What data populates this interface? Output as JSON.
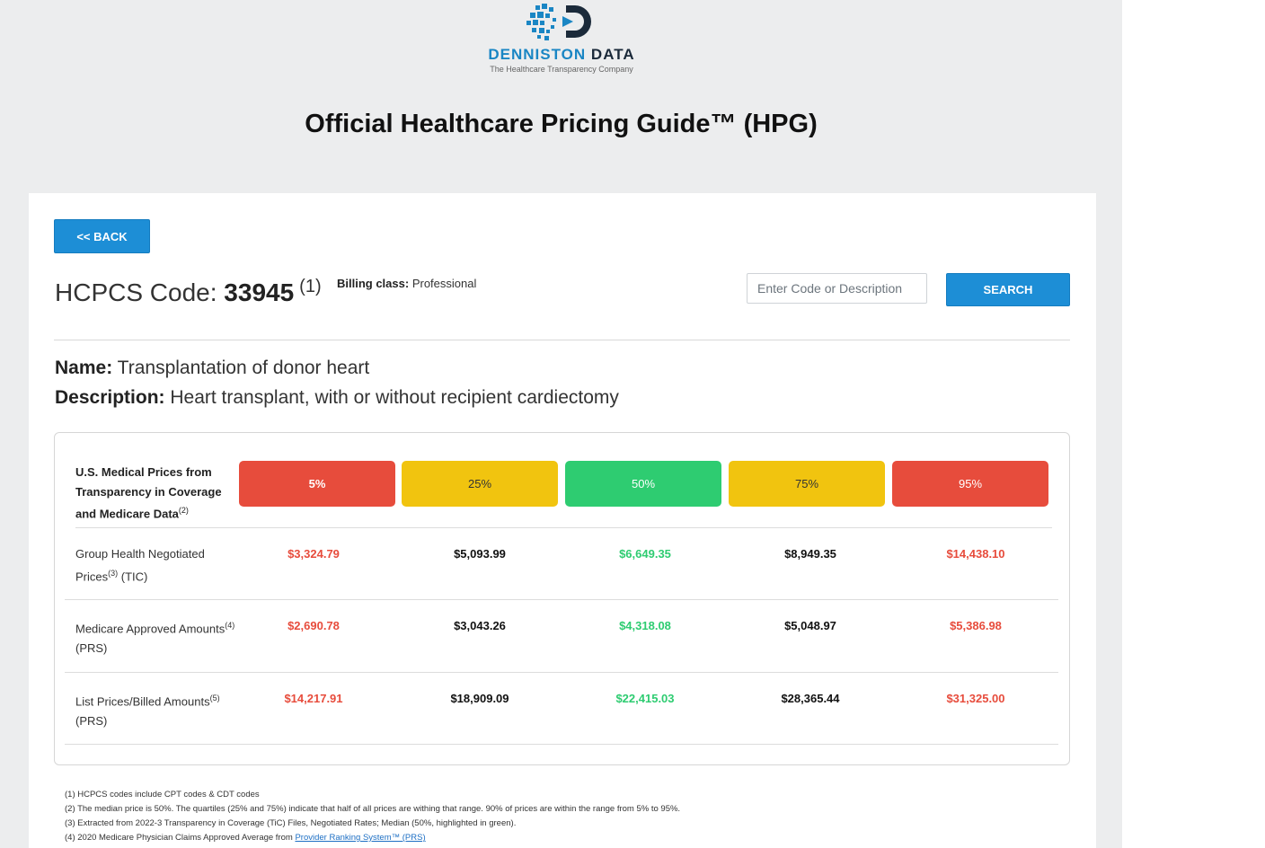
{
  "logo": {
    "name_part1": "DENNISTON",
    "name_part2": "DATA",
    "tagline": "The Healthcare Transparency Company",
    "colors": {
      "blue": "#1a86c4",
      "dark": "#1b2a3a"
    }
  },
  "page_title": "Official Healthcare Pricing Guide™ (HPG)",
  "back_button": "<< BACK",
  "code": {
    "prefix": "HCPCS Code:",
    "value": "33945",
    "footnote_ref": "(1)",
    "billing_label": "Billing class:",
    "billing_value": "Professional"
  },
  "search": {
    "placeholder": "Enter Code or Description",
    "button": "SEARCH"
  },
  "procedure": {
    "name_label": "Name:",
    "name": "Transplantation of donor heart",
    "description_label": "Description:",
    "description": "Heart transplant, with or without recipient cardiectomy"
  },
  "table": {
    "header_label": "U.S. Medical Prices from Transparency in Coverage and Medicare Data",
    "header_ref": "(2)",
    "percentiles": [
      "5%",
      "25%",
      "50%",
      "75%",
      "95%"
    ],
    "rows": [
      {
        "label_a": "Group Health Negotiated Prices",
        "ref": "(3)",
        "label_b": "(TIC)",
        "values": [
          "$3,324.79",
          "$5,093.99",
          "$6,649.35",
          "$8,949.35",
          "$14,438.10"
        ]
      },
      {
        "label_a": "Medicare Approved Amounts",
        "ref": "(4)",
        "label_b": "(PRS)",
        "values": [
          "$2,690.78",
          "$3,043.26",
          "$4,318.08",
          "$5,048.97",
          "$5,386.98"
        ]
      },
      {
        "label_a": "List Prices/Billed Amounts",
        "ref": "(5)",
        "label_b": "(PRS)",
        "values": [
          "$14,217.91",
          "$18,909.09",
          "$22,415.03",
          "$28,365.44",
          "$31,325.00"
        ]
      }
    ],
    "colors": {
      "red": "#e74c3c",
      "yellow": "#f1c40f",
      "green": "#2ecc71"
    }
  },
  "footnotes": {
    "f1": "(1) HCPCS codes include CPT codes & CDT codes",
    "f2": "(2) The median price is 50%. The quartiles (25% and 75%) indicate that half of all prices are withing that range. 90% of prices are within the range from 5% to 95%.",
    "f3": "(3) Extracted from 2022-3 Transparency in Coverage (TiC) Files, Negotiated Rates; Median (50%, highlighted in green).",
    "f4_prefix": "(4) 2020 Medicare Physician Claims Approved Average from",
    "f4_link": "Provider Ranking System™ (PRS)"
  }
}
